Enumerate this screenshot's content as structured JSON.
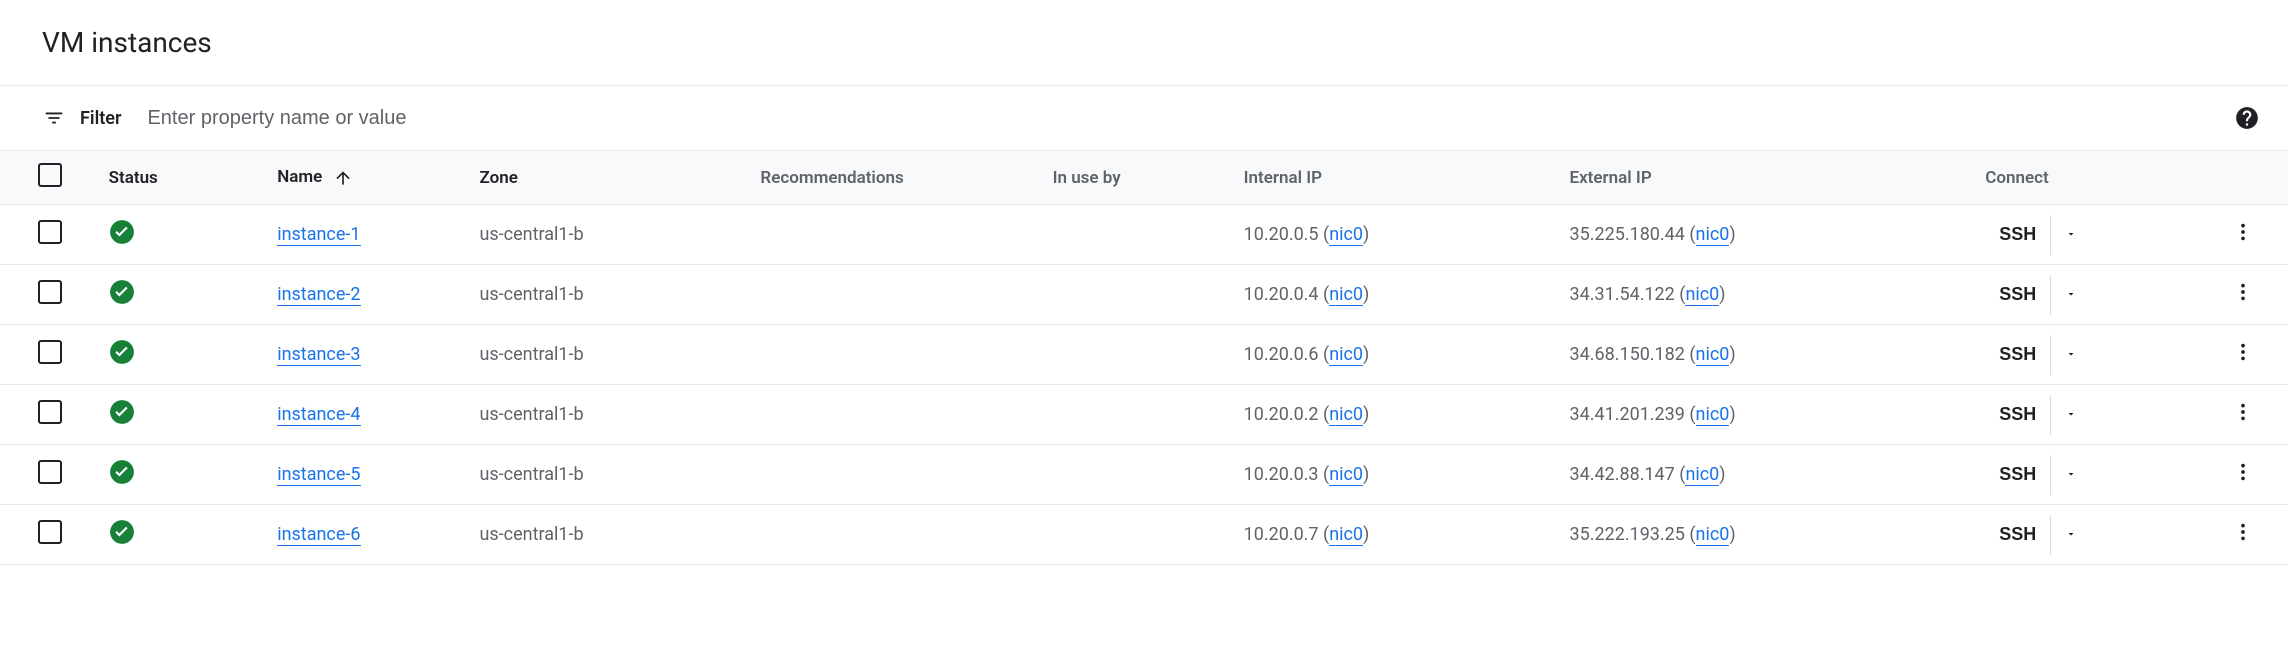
{
  "page_title": "VM instances",
  "filter": {
    "label": "Filter",
    "placeholder": "Enter property name or value"
  },
  "columns": {
    "status": "Status",
    "name": "Name",
    "zone": "Zone",
    "recommendations": "Recommendations",
    "in_use_by": "In use by",
    "internal_ip": "Internal IP",
    "external_ip": "External IP",
    "connect": "Connect"
  },
  "ssh_label": "SSH",
  "nic_label": "nic0",
  "rows": [
    {
      "name": "instance-1",
      "zone": "us-central1-b",
      "internal_ip": "10.20.0.5",
      "external_ip": "35.225.180.44"
    },
    {
      "name": "instance-2",
      "zone": "us-central1-b",
      "internal_ip": "10.20.0.4",
      "external_ip": "34.31.54.122"
    },
    {
      "name": "instance-3",
      "zone": "us-central1-b",
      "internal_ip": "10.20.0.6",
      "external_ip": "34.68.150.182"
    },
    {
      "name": "instance-4",
      "zone": "us-central1-b",
      "internal_ip": "10.20.0.2",
      "external_ip": "34.41.201.239"
    },
    {
      "name": "instance-5",
      "zone": "us-central1-b",
      "internal_ip": "10.20.0.3",
      "external_ip": "34.42.88.147"
    },
    {
      "name": "instance-6",
      "zone": "us-central1-b",
      "internal_ip": "10.20.0.7",
      "external_ip": "35.222.193.25"
    }
  ]
}
